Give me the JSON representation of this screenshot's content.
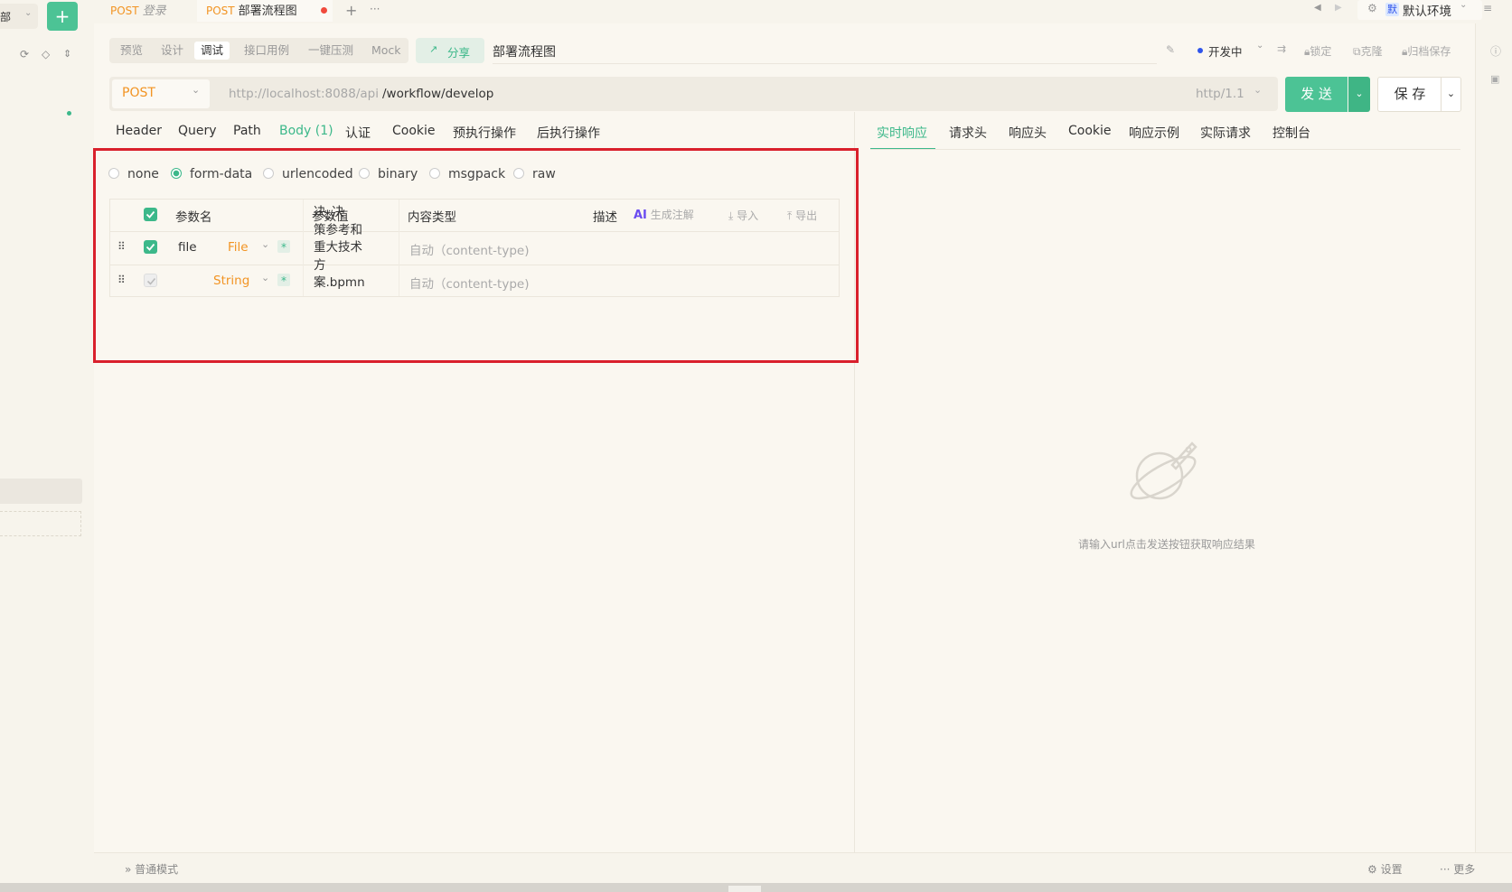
{
  "sidebar": {
    "folder_label": "部",
    "add_button": "+"
  },
  "tabs": [
    {
      "method": "POST",
      "title": "登录",
      "active": false
    },
    {
      "method": "POST",
      "title": "部署流程图",
      "active": true
    }
  ],
  "tabbar": {
    "add_tab": "+",
    "more_tabs": "···",
    "env_badge": "默",
    "env_name": "默认环境"
  },
  "toolbar": {
    "modes": [
      "预览",
      "设计",
      "调试",
      "接口用例",
      "一键压测",
      "Mock"
    ],
    "active_mode": "调试",
    "share_label": "分享",
    "api_name": "部署流程图",
    "status_label": "开发中",
    "lock_label": "锁定",
    "clone_label": "克隆",
    "archive_label": "归档保存"
  },
  "request": {
    "method": "POST",
    "base_url": "http://localhost:8088/api",
    "path": "/workflow/develop",
    "http_version": "http/1.1",
    "send_label": "发 送",
    "save_label": "保 存"
  },
  "request_tabs": [
    "Header",
    "Query",
    "Path",
    "Body (1)",
    "认证",
    "Cookie",
    "预执行操作",
    "后执行操作"
  ],
  "active_request_tab": "Body (1)",
  "body_types": [
    "none",
    "form-data",
    "urlencoded",
    "binary",
    "msgpack",
    "raw"
  ],
  "active_body_type": "form-data",
  "params_table": {
    "headers": {
      "name": "参数名",
      "value": "参数值",
      "content_type": "内容类型",
      "description": "描述",
      "ai_badge": "AI",
      "ai_generate": "生成注解",
      "import": "导入",
      "export": "导出"
    },
    "rows": [
      {
        "name": "file",
        "type": "File",
        "checked": true,
        "value_lines": [
          "决_决",
          "策参考和",
          "重大技术",
          "方",
          "案.bpmn"
        ],
        "content_type": "自动（content-type)"
      },
      {
        "name": "",
        "type": "String",
        "checked": false,
        "value_lines": [],
        "content_type": "自动（content-type)"
      }
    ],
    "required_mark": "*"
  },
  "response_tabs": [
    "实时响应",
    "请求头",
    "响应头",
    "Cookie",
    "响应示例",
    "实际请求",
    "控制台"
  ],
  "active_response_tab": "实时响应",
  "response_empty_text": "请输入url点击发送按钮获取响应结果",
  "footer": {
    "mode_label": "普通模式",
    "settings_label": "设置",
    "more_label": "更多"
  },
  "colors": {
    "accent": "#3cb88a",
    "method": "#f29423",
    "highlight_box": "#d9202c",
    "status_dot": "#2f54eb"
  }
}
